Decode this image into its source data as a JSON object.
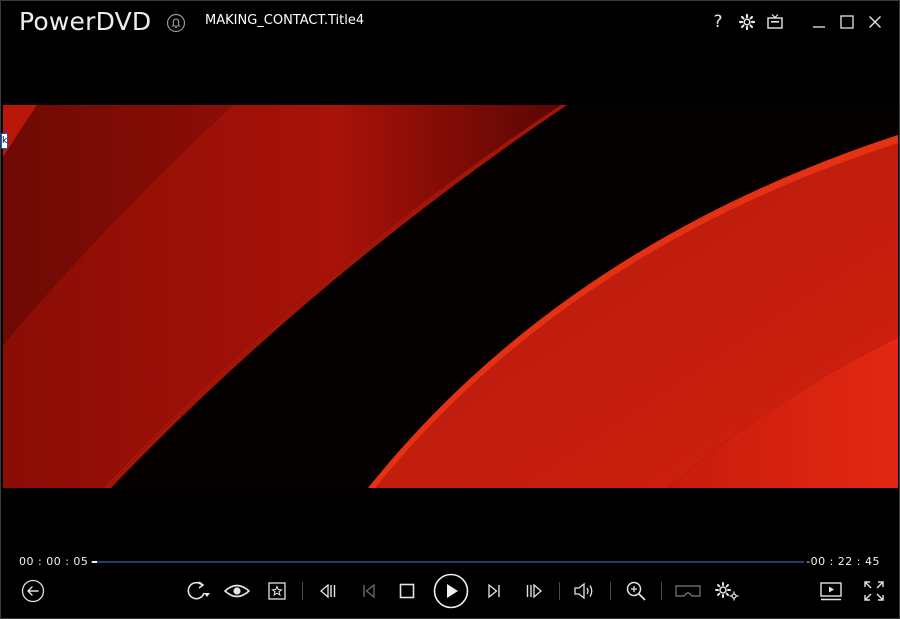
{
  "app": {
    "title": "PowerDVD",
    "document_title": "MAKING_CONTACT.Title4"
  },
  "titlebar_icons": [
    "bell-icon",
    "help-icon",
    "settings-gear-icon",
    "tv-mode-icon",
    "minimize-icon",
    "maximize-icon",
    "close-icon"
  ],
  "titlebar": {
    "help_label": "?"
  },
  "video": {
    "edge_tag": "k"
  },
  "playback": {
    "current_time": "00 : 00 : 05",
    "remaining_time": "-00 : 22 : 45",
    "progress_fraction": 0.004
  },
  "controls": [
    "back-arrow-icon",
    "repeat-icon",
    "eye-icon",
    "bookmark-star-icon",
    "previous-chapter-icon",
    "step-back-icon",
    "stop-icon",
    "play-icon",
    "next-chapter-icon",
    "step-forward-icon",
    "volume-icon",
    "zoom-icon",
    "vr-headset-icon",
    "advanced-settings-icon",
    "playlist-icon",
    "fullscreen-icon"
  ],
  "colors": {
    "accent": "#1c3f6e",
    "progress": "#e9f3ff",
    "video_red": "#d0160b"
  }
}
